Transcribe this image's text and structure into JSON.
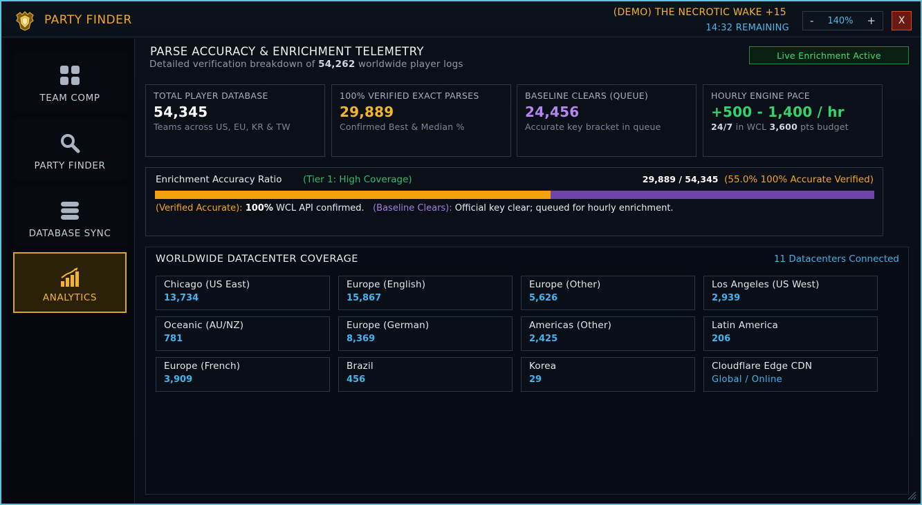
{
  "header": {
    "app_title": "PARTY FINDER",
    "dungeon": "(DEMO) THE NECROTIC WAKE +15",
    "remaining": "14:32 REMAINING",
    "zoom_minus": "-",
    "zoom_value": "140%",
    "zoom_plus": "+",
    "close_label": "X"
  },
  "sidebar": {
    "items": [
      {
        "label": "TEAM COMP",
        "icon": "grid-icon"
      },
      {
        "label": "PARTY FINDER",
        "icon": "search-icon"
      },
      {
        "label": "DATABASE SYNC",
        "icon": "database-icon"
      },
      {
        "label": "ANALYTICS",
        "icon": "chart-icon",
        "active": true
      }
    ]
  },
  "main": {
    "title": "PARSE ACCURACY & ENRICHMENT TELEMETRY",
    "subtitle_prefix": "Detailed verification breakdown of ",
    "subtitle_count": "54,262",
    "subtitle_suffix": " worldwide player logs",
    "live_badge": "Live Enrichment Active",
    "stats": [
      {
        "label": "TOTAL PLAYER DATABASE",
        "value": "54,345",
        "note": "Teams across US, EU, KR & TW",
        "color": "#ffffff"
      },
      {
        "label": "100% VERIFIED EXACT PARSES",
        "value": "29,889",
        "note": "Confirmed Best & Median %",
        "color": "#f5b52a"
      },
      {
        "label": "BASELINE CLEARS (QUEUE)",
        "value": "24,456",
        "note": "Accurate key bracket in queue",
        "color": "#b486f0"
      },
      {
        "label": "HOURLY ENGINE PACE",
        "value": "+500 - 1,400 / hr",
        "note_a": "24/7",
        "note_b": " in WCL ",
        "note_c": "3,600",
        "note_d": " pts budget",
        "color": "#33d36b"
      }
    ],
    "ratio": {
      "title": "Enrichment Accuracy Ratio",
      "tier": "(Tier 1: High Coverage)",
      "fraction": "29,889 / 54,345",
      "percent_text": "(55.0% 100% Accurate Verified)",
      "fill_fraction": 0.55,
      "legend_verified_tag": "(Verified Accurate):",
      "legend_verified_bold": "100%",
      "legend_verified_text": " WCL API confirmed.",
      "legend_baseline_tag": "(Baseline Clears):",
      "legend_baseline_text": " Official key clear; queued for hourly enrichment."
    },
    "datacenters": {
      "title": "WORLDWIDE DATACENTER COVERAGE",
      "connected": "11 Datacenters Connected",
      "items": [
        {
          "name": "Chicago (US East)",
          "value": "13,734"
        },
        {
          "name": "Europe (English)",
          "value": "15,867"
        },
        {
          "name": "Europe (Other)",
          "value": "5,626"
        },
        {
          "name": "Los Angeles (US West)",
          "value": "2,939"
        },
        {
          "name": "Oceanic (AU/NZ)",
          "value": "781"
        },
        {
          "name": "Europe (German)",
          "value": "8,369"
        },
        {
          "name": "Americas (Other)",
          "value": "2,425"
        },
        {
          "name": "Latin America",
          "value": "206"
        },
        {
          "name": "Europe (French)",
          "value": "3,909"
        },
        {
          "name": "Brazil",
          "value": "456"
        },
        {
          "name": "Korea",
          "value": "29"
        },
        {
          "name": "Cloudflare Edge CDN",
          "value": "Global / Online"
        }
      ]
    }
  }
}
